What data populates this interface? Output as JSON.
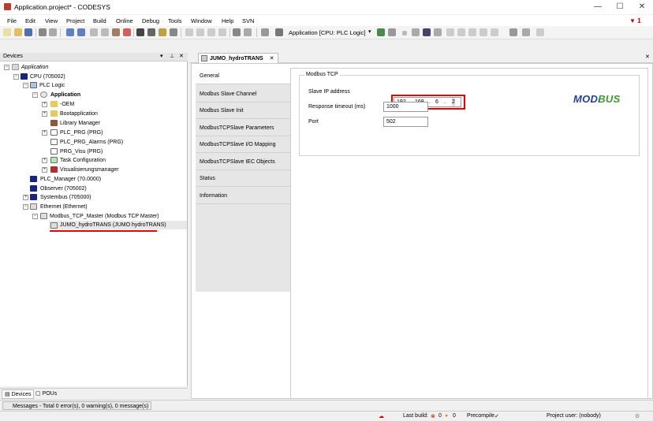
{
  "window": {
    "title": "Application.project* - CODESYS",
    "minimize": "—",
    "maximize": "☐",
    "close": "✕"
  },
  "menu": [
    "File",
    "Edit",
    "View",
    "Project",
    "Build",
    "Online",
    "Debug",
    "Tools",
    "Window",
    "Help",
    "SVN"
  ],
  "notifications": {
    "count": "1"
  },
  "toolbar": {
    "active_app": "Application [CPU: PLC Logic]"
  },
  "devices": {
    "header": "Devices",
    "tree": [
      {
        "label": "Application",
        "italic": true
      },
      {
        "label": "CPU (705002)"
      },
      {
        "label": "PLC Logic"
      },
      {
        "label": "Application",
        "bold": true
      },
      {
        "label": "-OEM"
      },
      {
        "label": "Bootapplication"
      },
      {
        "label": "Library Manager"
      },
      {
        "label": "PLC_PRG (PRG)"
      },
      {
        "label": "PLC_PRG_Alarms (PRG)"
      },
      {
        "label": "PRG_Visu (PRG)"
      },
      {
        "label": "Task Configuration"
      },
      {
        "label": "Visualisierungsmanager"
      },
      {
        "label": "PLC_Manager (70.0000)"
      },
      {
        "label": "Observer (705002)"
      },
      {
        "label": "Systembus (705000)"
      },
      {
        "label": "Ethernet (Ethernet)"
      },
      {
        "label": "Modbus_TCP_Master (Modbus TCP Master)"
      },
      {
        "label": "JUMO_hydroTRANS (JUMO hydroTRANS)",
        "selected": true
      }
    ],
    "tabs": [
      "Devices",
      "POUs"
    ]
  },
  "messages": {
    "summary": "Messages - Total 0 error(s), 0 warning(s), 0 message(s)"
  },
  "status": {
    "last_build_label": "Last build:",
    "errors": "0",
    "warnings": "0",
    "precompile": "Precompile",
    "project_user": "Project user: (nobody)"
  },
  "editor": {
    "tab_title": "JUMO_hydroTRANS",
    "tab_close": "✕",
    "side_tabs": [
      "General",
      "Modbus Slave Channel",
      "Modbus Slave Init",
      "ModbusTCPSlave Parameters",
      "ModbusTCPSlave I/O Mapping",
      "ModbusTCPSlave IEC Objects",
      "Status",
      "Information"
    ],
    "active_side_tab": "General",
    "group_title": "Modbus TCP",
    "slave_ip_label": "Slave IP address",
    "ip": [
      "192",
      "168",
      "6",
      "2"
    ],
    "timeout_label": "Response timeout (ms)",
    "timeout_value": "1000",
    "port_label": "Port",
    "port_value": "502",
    "logo_text": "MODBUS"
  },
  "colors": {
    "selection_underline": "#e00000",
    "logo_blue": "#1f3f9f",
    "logo_green": "#3a9a2a"
  }
}
